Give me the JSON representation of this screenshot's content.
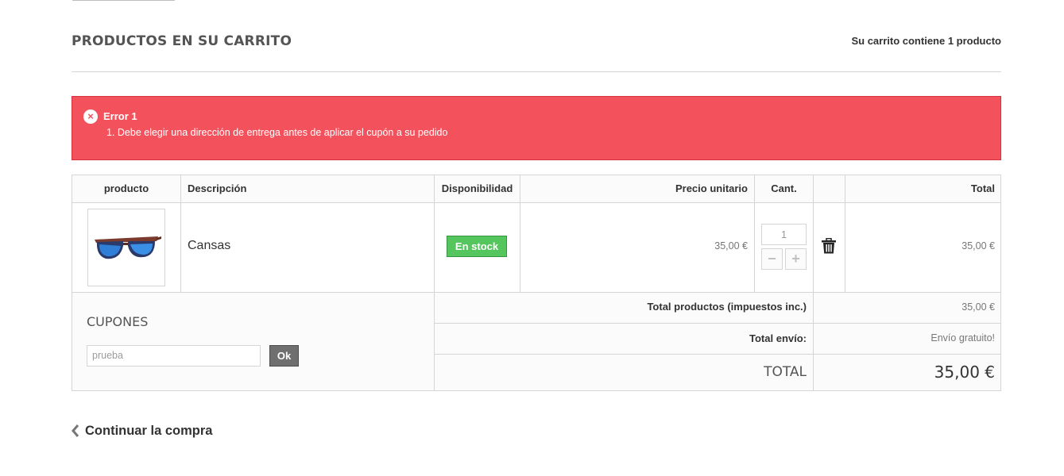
{
  "header": {
    "title": "PRODUCTOS EN SU CARRITO",
    "cart_count": "Su carrito contiene 1 producto"
  },
  "alert": {
    "title": "Error 1",
    "messages": [
      "1. Debe elegir una dirección de entrega antes de aplicar el cupón a su pedido"
    ],
    "icon": "close-circle-icon",
    "color": "#f3515c"
  },
  "table": {
    "headers": {
      "product": "producto",
      "description": "Descripción",
      "availability": "Disponibilidad",
      "unit_price": "Precio unitario",
      "qty": "Cant.",
      "delete": "",
      "total": "Total"
    },
    "rows": [
      {
        "image": "sunglasses-thumbnail",
        "name": "Cansas",
        "availability": "En stock",
        "unit_price": "35,00 €",
        "qty": "1",
        "total": "35,00 €"
      }
    ]
  },
  "coupons": {
    "title": "CUPONES",
    "input_value": "prueba",
    "submit_label": "Ok"
  },
  "summary": {
    "products_label": "Total productos (impuestos inc.)",
    "products_value": "35,00 €",
    "shipping_label": "Total envío:",
    "shipping_value": "Envío gratuito!",
    "total_label": "TOTAL",
    "total_value": "35,00 €"
  },
  "footer": {
    "continue_label": "Continuar la compra"
  },
  "colors": {
    "alert_bg": "#f3515c",
    "stock_badge": "#55c65e",
    "ok_button": "#6f6f6f"
  }
}
